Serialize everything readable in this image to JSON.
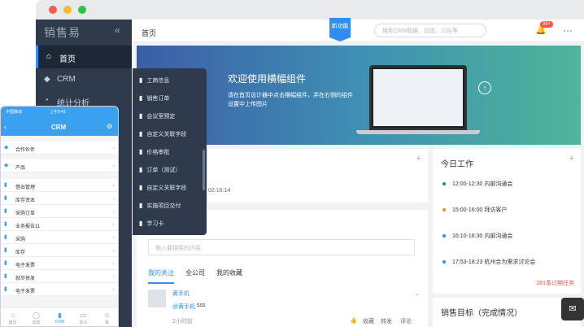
{
  "sidebar": {
    "logo": "销售易",
    "collapse": "«",
    "items": [
      {
        "icon": "⌂",
        "label": "首页"
      },
      {
        "icon": "◆",
        "label": "CRM"
      },
      {
        "icon": "◔",
        "label": "统计分析"
      }
    ]
  },
  "header": {
    "breadcrumb": "首页",
    "new_feature": "新功能",
    "search_placeholder": "搜索CRM数据、动态、公告等",
    "notification_badge": "99+",
    "more": "···"
  },
  "banner": {
    "title": "欢迎使用横幅组件",
    "subtitle": "请在首页设计器中点击横幅组件，并在右侧的组件设置中上传图片",
    "upload_icon": "↑"
  },
  "flyout": {
    "items": [
      "工商信息",
      "销售订单",
      "会议室预定",
      "自定义关联字段",
      "价格审批",
      "订单（测试）",
      "自定义关联字段",
      "实施项目交付",
      "学习卡"
    ]
  },
  "feed": {
    "partial_time": "02:16:14",
    "placeholder": "输入要搜索的内容",
    "tabs": [
      "我的关注",
      "全公司",
      "我的收藏"
    ],
    "post": {
      "author": "黄手机",
      "mention": "@黄手机",
      "text": "sss",
      "time": "2小时前",
      "actions": [
        "赞",
        "收藏",
        "转发",
        "评论"
      ]
    }
  },
  "today": {
    "title": "今日工作",
    "items": [
      {
        "time": "12:00-12:30",
        "text": "内部沟通会",
        "color": "#2e8b57"
      },
      {
        "time": "15:00-16:00",
        "text": "拜访客户",
        "color": "#f08a24"
      },
      {
        "time": "16:10-16:30",
        "text": "内部沟通会",
        "color": "#2f8ef4"
      },
      {
        "time": "17:53-18:23",
        "text": "杭州合为需求讨论会",
        "color": "#2f8ef4"
      }
    ],
    "overdue": "281条过期任务"
  },
  "sales_target": {
    "title": "销售目标（完成情况）"
  },
  "phone": {
    "carrier": "中国移动",
    "clock": "上午9:41",
    "title": "CRM",
    "rows": [
      {
        "icon": "◆",
        "label": "合作伙伴"
      },
      {
        "icon": "◆",
        "label": "产品"
      },
      {
        "icon": "▮",
        "label": "借出管理"
      },
      {
        "icon": "▮",
        "label": "库存资本"
      },
      {
        "icon": "▮",
        "label": "采购订单"
      },
      {
        "icon": "▮",
        "label": "业务报告11"
      },
      {
        "icon": "▮",
        "label": "采购"
      },
      {
        "icon": "▮",
        "label": "库存"
      },
      {
        "icon": "▮",
        "label": "电子发票"
      },
      {
        "icon": "▮",
        "label": "就尽快发"
      },
      {
        "icon": "▮",
        "label": "电子发票"
      }
    ],
    "tabs": [
      {
        "icon": "⌂",
        "label": "首页"
      },
      {
        "icon": "◯",
        "label": "动态"
      },
      {
        "icon": "▮",
        "label": "CRM"
      },
      {
        "icon": "▭",
        "label": "办公"
      },
      {
        "icon": "☺",
        "label": "我"
      }
    ]
  },
  "chat_icon": "✉"
}
